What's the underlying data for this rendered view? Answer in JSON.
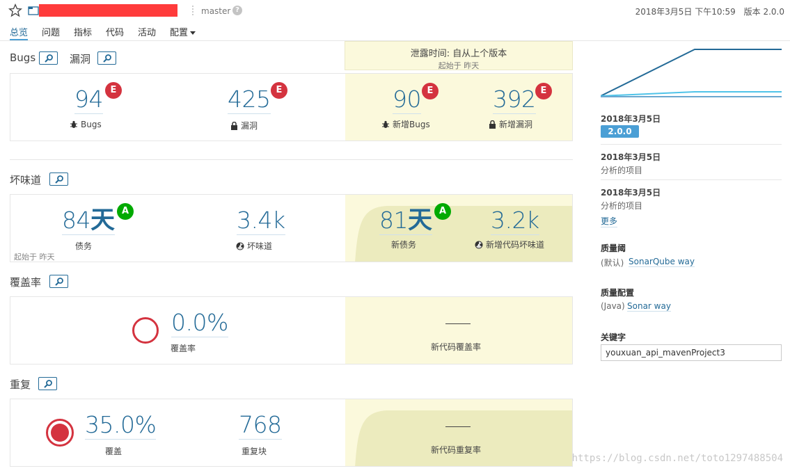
{
  "header": {
    "branch": "master",
    "date": "2018年3月5日 下午10:59",
    "version": "版本 2.0.0"
  },
  "nav": {
    "tabs": [
      "总览",
      "问题",
      "指标",
      "代码",
      "活动",
      "配置"
    ]
  },
  "leak": {
    "title": "泄露时间: 自从上个版本",
    "subtitle": "起始于 昨天"
  },
  "reliability": {
    "title_bugs": "Bugs",
    "title_vuln": "漏洞",
    "bugs_value": "94",
    "bugs_rating": "E",
    "bugs_label": "Bugs",
    "vuln_value": "425",
    "vuln_rating": "E",
    "vuln_label": "漏洞",
    "new_bugs_value": "90",
    "new_bugs_rating": "E",
    "new_bugs_label": "新增Bugs",
    "new_vuln_value": "392",
    "new_vuln_rating": "E",
    "new_vuln_label": "新增漏洞"
  },
  "maintainability": {
    "title": "坏味道",
    "debt_value": "84",
    "debt_unit": "天",
    "debt_rating": "A",
    "debt_label": "债务",
    "smells_value": "3.4k",
    "smells_label": "坏味道",
    "since_note": "起始于 昨天",
    "new_debt_value": "81",
    "new_debt_unit": "天",
    "new_debt_rating": "A",
    "new_debt_label": "新债务",
    "new_smells_value": "3.2k",
    "new_smells_label": "新增代码坏味道"
  },
  "coverage": {
    "title": "覆盖率",
    "value": "0.0%",
    "label": "覆盖率",
    "new_label": "新代码覆盖率"
  },
  "duplications": {
    "title": "重复",
    "value": "35.0%",
    "label": "覆盖",
    "blocks_value": "768",
    "blocks_label": "重复块",
    "new_label": "新代码重复率"
  },
  "sidebar": {
    "history": [
      {
        "date": "2018年3月5日",
        "badge": "2.0.0"
      },
      {
        "date": "2018年3月5日",
        "sub": "分析的项目"
      },
      {
        "date": "2018年3月5日",
        "sub": "分析的项目"
      }
    ],
    "more": "更多",
    "quality_gate_title": "质量阈",
    "quality_gate_prefix": "(默认)",
    "quality_gate_link": "SonarQube way",
    "quality_profile_title": "质量配置",
    "quality_profile_prefix": "(Java)",
    "quality_profile_link": "Sonar way",
    "keywords_title": "关键字",
    "keywords_value": "youxuan_api_mavenProject3"
  },
  "colors": {
    "accent": "#236a97",
    "rating_e": "#d4333f",
    "rating_a": "#00aa00",
    "leak_bg": "#fbf9dc",
    "badge": "#4b9fd5",
    "redacted": "#ff3b3b"
  },
  "watermark": "https://blog.csdn.net/toto1297488504"
}
